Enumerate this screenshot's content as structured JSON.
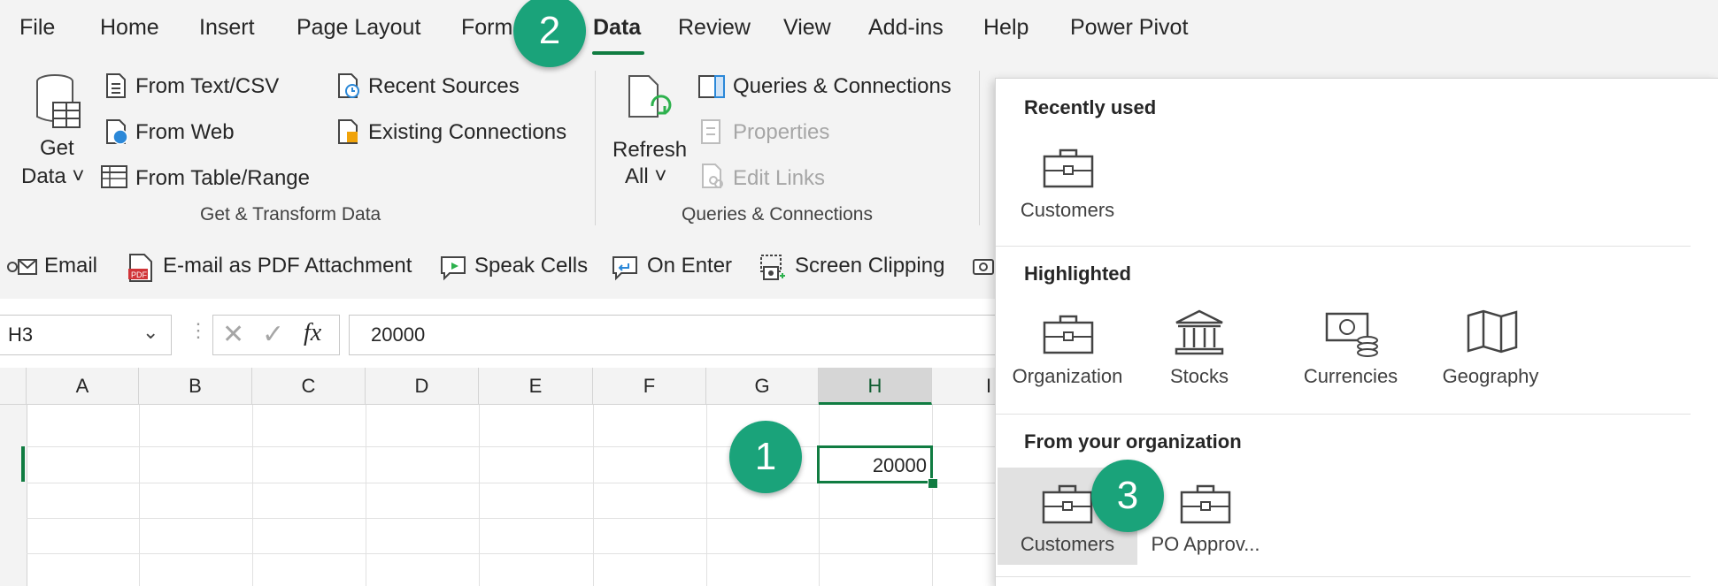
{
  "tabs": [
    "File",
    "Home",
    "Insert",
    "Page Layout",
    "Form",
    "Data",
    "Review",
    "View",
    "Add-ins",
    "Help",
    "Power Pivot"
  ],
  "active_tab": "Data",
  "ribbon": {
    "get_data": {
      "line1": "Get",
      "line2": "Data ˅"
    },
    "from_text_csv": "From Text/CSV",
    "from_web": "From Web",
    "from_table_range": "From Table/Range",
    "recent_sources": "Recent Sources",
    "existing_connections": "Existing Connections",
    "group_get_transform": "Get & Transform Data",
    "refresh_all": {
      "line1": "Refresh",
      "line2": "All ˅"
    },
    "queries_connections": "Queries & Connections",
    "properties": "Properties",
    "edit_links": "Edit Links",
    "group_queries": "Queries & Connections"
  },
  "qat": {
    "email": "Email",
    "email_pdf": "E-mail as PDF Attachment",
    "speak_cells": "Speak Cells",
    "on_enter": "On Enter",
    "screen_clipping": "Screen Clipping"
  },
  "formula_bar": {
    "name_box": "H3",
    "fx": "fx",
    "value": "20000"
  },
  "columns": [
    "A",
    "B",
    "C",
    "D",
    "E",
    "F",
    "G",
    "H",
    "I"
  ],
  "selected_column": "H",
  "active_cell_value": "20000",
  "panel": {
    "recently_used": {
      "title": "Recently used",
      "items": [
        "Customers"
      ]
    },
    "highlighted": {
      "title": "Highlighted",
      "items": [
        "Organization",
        "Stocks",
        "Currencies",
        "Geography"
      ]
    },
    "from_org": {
      "title": "From your organization",
      "items": [
        "Customers",
        "PO Approv..."
      ]
    }
  },
  "badges": [
    "1",
    "2",
    "3"
  ],
  "colors": {
    "accent": "#107c41",
    "badge": "#1aa37a",
    "selected_item_bg": "#e1e1e1"
  }
}
